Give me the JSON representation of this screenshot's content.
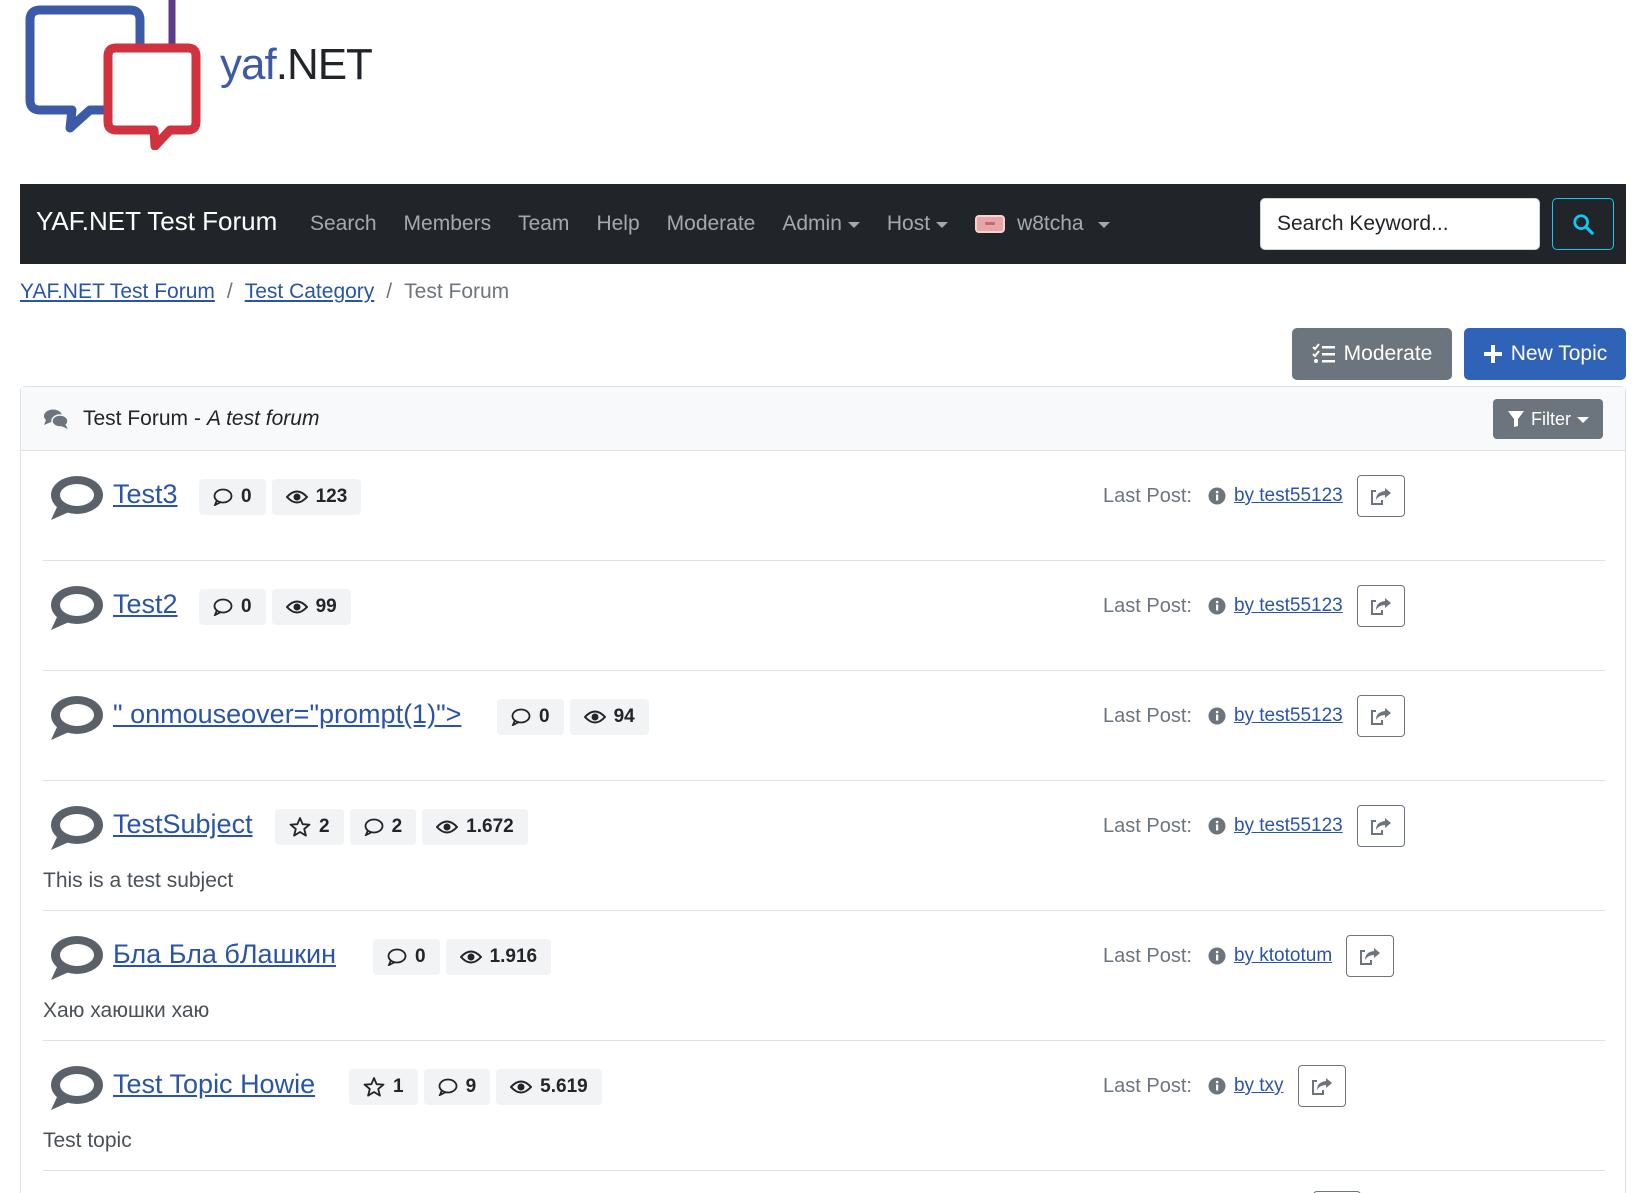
{
  "logo": {
    "text_yaf": "yaf",
    "text_dot": ".",
    "text_net": "NET"
  },
  "navbar": {
    "brand": "YAF.NET Test Forum",
    "items": [
      {
        "label": "Search"
      },
      {
        "label": "Members"
      },
      {
        "label": "Team"
      },
      {
        "label": "Help"
      },
      {
        "label": "Moderate"
      },
      {
        "label": "Admin"
      },
      {
        "label": "Host"
      }
    ],
    "user": "w8tcha",
    "search_placeholder": "Search Keyword..."
  },
  "breadcrumb": {
    "items": [
      "YAF.NET Test Forum",
      "Test Category"
    ],
    "sep": "/",
    "current": "Test Forum"
  },
  "actions": {
    "moderate": "Moderate",
    "new_topic": "New Topic"
  },
  "forum": {
    "name": "Test Forum",
    "dash": "-",
    "description": "A test forum",
    "filter": "Filter"
  },
  "topics": [
    {
      "title": "Test3",
      "replies": "0",
      "views": "123",
      "desc": "",
      "lastpost_label": "Last Post:",
      "lastpost_by": "by test55123"
    },
    {
      "title": "Test2",
      "replies": "0",
      "views": "99",
      "desc": "",
      "lastpost_label": "Last Post:",
      "lastpost_by": "by test55123"
    },
    {
      "title": "\" onmouseover=\"prompt(1)\">",
      "replies": "0",
      "views": "94",
      "desc": "",
      "lastpost_label": "Last Post:",
      "lastpost_by": "by test55123"
    },
    {
      "title": "TestSubject",
      "favorites": "2",
      "replies": "2",
      "views": "1.672",
      "desc": "This is a test subject",
      "lastpost_label": "Last Post:",
      "lastpost_by": "by test55123"
    },
    {
      "title": "Бла Бла бЛашкин",
      "replies": "0",
      "views": "1.916",
      "desc": "Хаю хаюшки хаю",
      "lastpost_label": "Last Post:",
      "lastpost_by": "by ktototum"
    },
    {
      "title": "Test Topic Howie",
      "favorites": "1",
      "replies": "9",
      "views": "5.619",
      "desc": "Test topic",
      "lastpost_label": "Last Post:",
      "lastpost_by": "by txy"
    }
  ],
  "colors": {
    "navbar": "#212529",
    "link": "#2a55a6",
    "primary": "#2f63b8",
    "secondary": "#6c757d",
    "info": "#0dcaf0"
  }
}
